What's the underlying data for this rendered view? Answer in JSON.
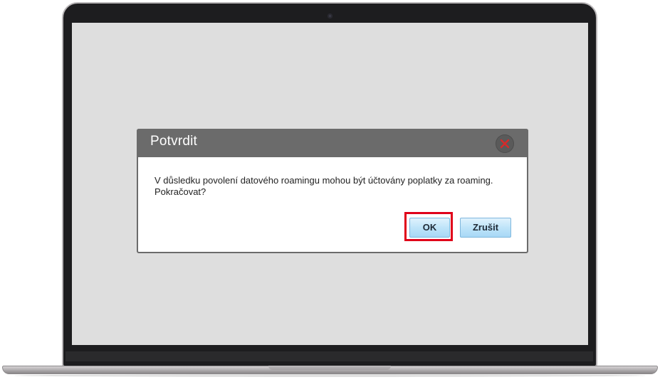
{
  "dialog": {
    "title": "Potvrdit",
    "message_line1": "V důsledku povolení datového roamingu mohou být účtovány poplatky za roaming.",
    "message_line2": "Pokračovat?",
    "ok_label": "OK",
    "cancel_label": "Zrušit",
    "close_icon": "close-x-icon"
  },
  "colors": {
    "header_bg": "#6b6b6b",
    "close_x": "#d62b2b",
    "button_bg": "#bfe4f9",
    "highlight": "#e0001a",
    "screen_bg": "#dedede"
  }
}
